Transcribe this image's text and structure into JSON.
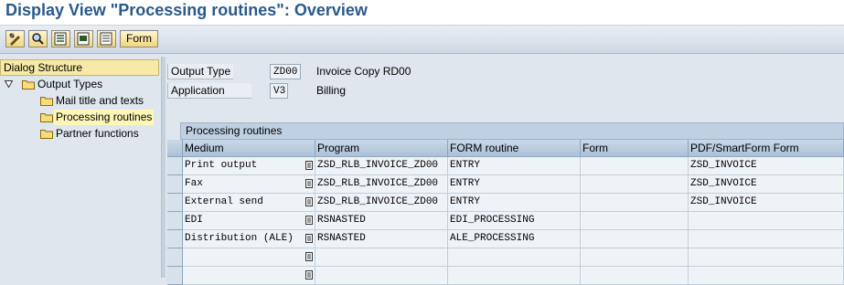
{
  "window": {
    "title": "Display View \"Processing routines\": Overview"
  },
  "toolbar": {
    "icons": [
      "display-change-icon",
      "find-icon",
      "select-all-icon",
      "select-block-icon",
      "deselect-all-icon"
    ],
    "form_label": "Form"
  },
  "tree": {
    "header": "Dialog Structure",
    "items": [
      {
        "label": "Output Types",
        "icon": "folder-open-icon"
      },
      {
        "label": "Mail title and texts",
        "icon": "folder-icon"
      },
      {
        "label": "Processing routines",
        "icon": "folder-open-icon",
        "selected": true
      },
      {
        "label": "Partner functions",
        "icon": "folder-icon"
      }
    ]
  },
  "header_fields": {
    "output_type": {
      "label": "Output Type",
      "value": "ZD00",
      "description": "Invoice Copy RD00"
    },
    "application": {
      "label": "Application",
      "value": "V3",
      "description": "Billing"
    }
  },
  "table": {
    "title": "Processing routines",
    "columns": [
      "Medium",
      "Program",
      "FORM routine",
      "Form",
      "PDF/SmartForm Form"
    ],
    "rows": [
      {
        "medium": "Print output",
        "program": "ZSD_RLB_INVOICE_ZD00",
        "form_routine": "ENTRY",
        "form": "",
        "pdf_form": "ZSD_INVOICE"
      },
      {
        "medium": "Fax",
        "program": "ZSD_RLB_INVOICE_ZD00",
        "form_routine": "ENTRY",
        "form": "",
        "pdf_form": "ZSD_INVOICE"
      },
      {
        "medium": "External send",
        "program": "ZSD_RLB_INVOICE_ZD00",
        "form_routine": "ENTRY",
        "form": "",
        "pdf_form": "ZSD_INVOICE"
      },
      {
        "medium": "EDI",
        "program": "RSNASTED",
        "form_routine": "EDI_PROCESSING",
        "form": "",
        "pdf_form": ""
      },
      {
        "medium": "Distribution (ALE)",
        "program": "RSNASTED",
        "form_routine": "ALE_PROCESSING",
        "form": "",
        "pdf_form": ""
      },
      {
        "medium": "",
        "program": "",
        "form_routine": "",
        "form": "",
        "pdf_form": ""
      },
      {
        "medium": "",
        "program": "",
        "form_routine": "",
        "form": "",
        "pdf_form": ""
      }
    ]
  },
  "colors": {
    "title": "#2a5a8a",
    "header_bg": "#f7e9a8",
    "selection": "#fff6b8"
  }
}
